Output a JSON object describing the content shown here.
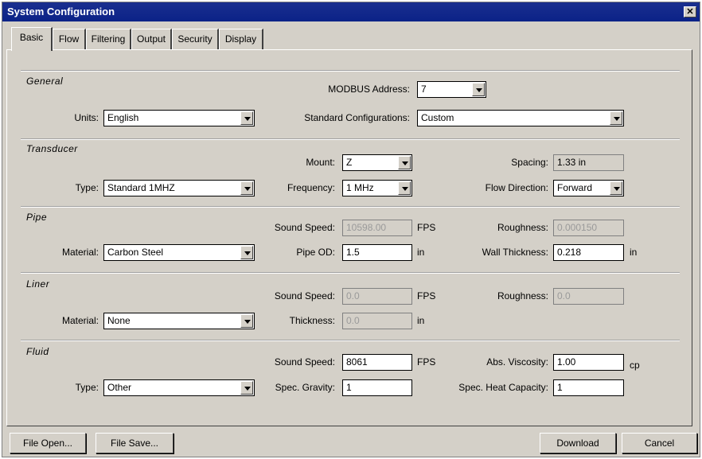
{
  "window": {
    "title": "System Configuration",
    "close": "✕"
  },
  "tabs": [
    "Basic",
    "Flow",
    "Filtering",
    "Output",
    "Security",
    "Display"
  ],
  "general": {
    "title": "General",
    "modbus_label": "MODBUS Address:",
    "modbus_value": "7",
    "units_label": "Units:",
    "units_value": "English",
    "std_config_label": "Standard Configurations:",
    "std_config_value": "Custom"
  },
  "transducer": {
    "title": "Transducer",
    "mount_label": "Mount:",
    "mount_value": "Z",
    "spacing_label": "Spacing:",
    "spacing_value": "1.33 in",
    "type_label": "Type:",
    "type_value": "Standard 1MHZ",
    "frequency_label": "Frequency:",
    "frequency_value": "1 MHz",
    "flow_dir_label": "Flow Direction:",
    "flow_dir_value": "Forward"
  },
  "pipe": {
    "title": "Pipe",
    "sound_speed_label": "Sound Speed:",
    "sound_speed_value": "10598.00",
    "sound_speed_unit": "FPS",
    "roughness_label": "Roughness:",
    "roughness_value": "0.000150",
    "material_label": "Material:",
    "material_value": "Carbon Steel",
    "od_label": "Pipe OD:",
    "od_value": "1.5",
    "od_unit": "in",
    "wall_label": "Wall Thickness:",
    "wall_value": "0.218",
    "wall_unit": "in"
  },
  "liner": {
    "title": "Liner",
    "sound_speed_label": "Sound Speed:",
    "sound_speed_value": "0.0",
    "sound_speed_unit": "FPS",
    "roughness_label": "Roughness:",
    "roughness_value": "0.0",
    "material_label": "Material:",
    "material_value": "None",
    "thickness_label": "Thickness:",
    "thickness_value": "0.0",
    "thickness_unit": "in"
  },
  "fluid": {
    "title": "Fluid",
    "sound_speed_label": "Sound Speed:",
    "sound_speed_value": "8061",
    "sound_speed_unit": "FPS",
    "viscosity_label": "Abs. Viscosity:",
    "viscosity_value": "1.00",
    "viscosity_unit": "cp",
    "type_label": "Type:",
    "type_value": "Other",
    "gravity_label": "Spec. Gravity:",
    "gravity_value": "1",
    "heat_label": "Spec. Heat Capacity:",
    "heat_value": "1"
  },
  "buttons": {
    "file_open": "File Open...",
    "file_save": "File Save...",
    "download": "Download",
    "cancel": "Cancel"
  }
}
